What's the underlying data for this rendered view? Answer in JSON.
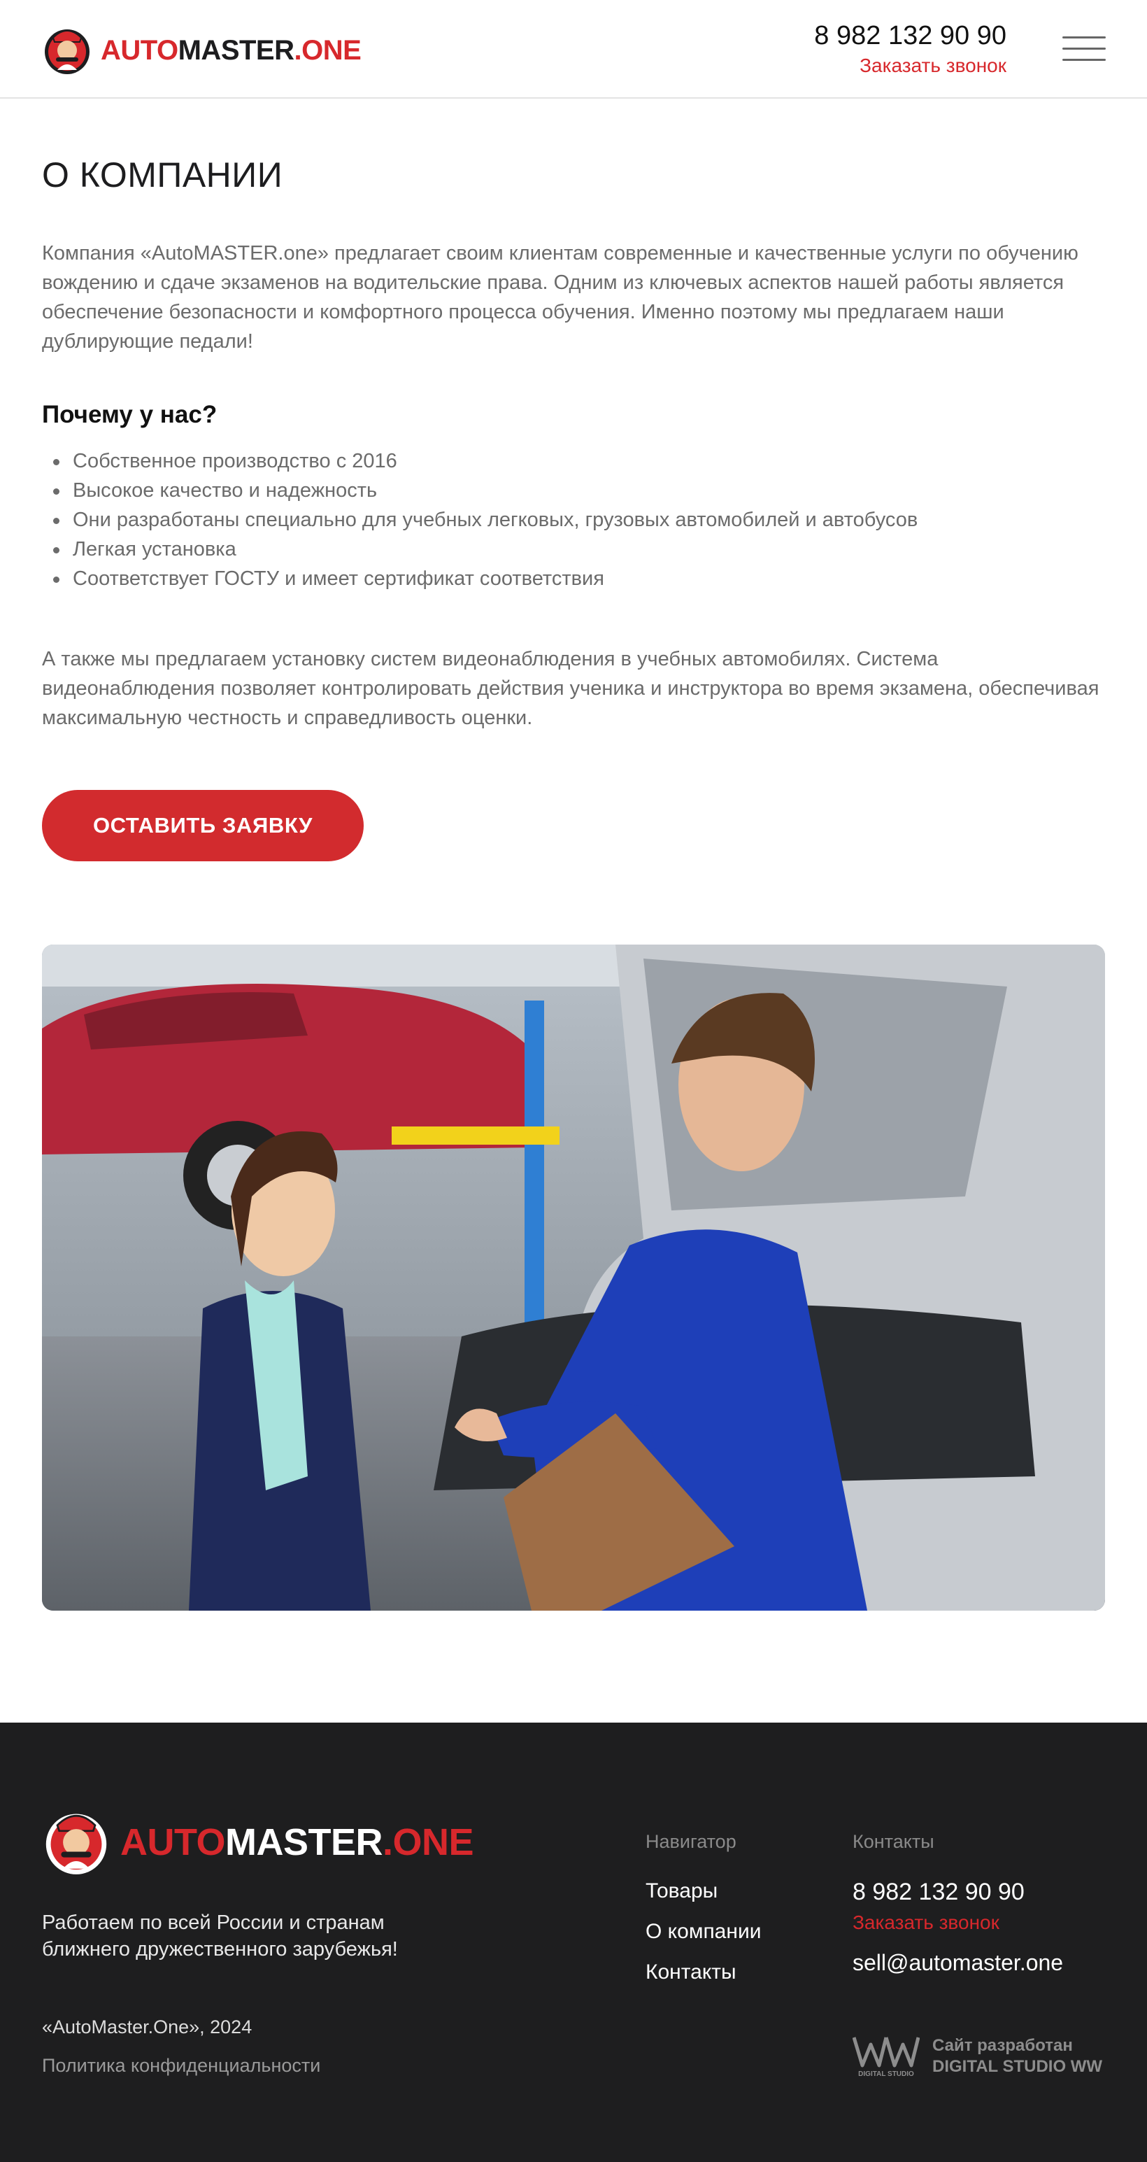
{
  "header": {
    "logo": {
      "part1": "AUTO",
      "part2": "MASTER",
      "part3": ".ONE"
    },
    "phone": "8 982 132 90 90",
    "callback_label": "Заказать звонок",
    "menu_icon": "hamburger-menu-icon"
  },
  "main": {
    "title": "О КОМПАНИИ",
    "intro": "Компания «AutoMASTER.one» предлагает своим клиентам современные и качественные услуги по обучению вождению и сдаче экзаменов на водительские права. Одним из ключевых аспектов нашей работы является обеспечение безопасности и комфортного процесса обучения. Именно поэтому мы предлагаем наши дублирующие педали!",
    "why_title": "Почему у нас?",
    "why_items": [
      "Собственное производство с 2016",
      "Высокое качество и надежность",
      "Они разработаны специально для учебных легковых, грузовых автомобилей и автобусов",
      "Легкая установка",
      "Соответствует ГОСТУ и имеет сертификат  соответствия"
    ],
    "video_text": "А также мы предлагаем установку систем видеонаблюдения в учебных автомобилях. Система видеонаблюдения позволяет контролировать действия ученика и инструктора во время экзамена, обеспечивая максимальную честность и справедливость оценки.",
    "cta_label": "ОСТАВИТЬ ЗАЯВКУ"
  },
  "footer": {
    "logo": {
      "part1": "AUTO",
      "part2": "MASTER",
      "part3": ".ONE"
    },
    "tagline_line1": "Работаем по всей России и странам",
    "tagline_line2": "ближнего дружественного зарубежья!",
    "copyright": "«AutoMaster.One», 2024",
    "policy": "Политика конфиденциальности",
    "nav_title": "Навигатор",
    "nav_items": [
      "Товары",
      "О компании",
      "Контакты"
    ],
    "contacts_title": "Контакты",
    "phone": "8 982 132 90 90",
    "callback_label": "Заказать звонок",
    "email": "sell@automaster.one",
    "dev_line1": "Сайт разработан",
    "dev_line2": "DIGITAL STUDIO WW",
    "dev_logo_caption": "DIGITAL STUDIO"
  },
  "colors": {
    "accent": "#d7282c",
    "footer_bg": "#1e1e1f",
    "text_gray": "#6b6b6b"
  }
}
